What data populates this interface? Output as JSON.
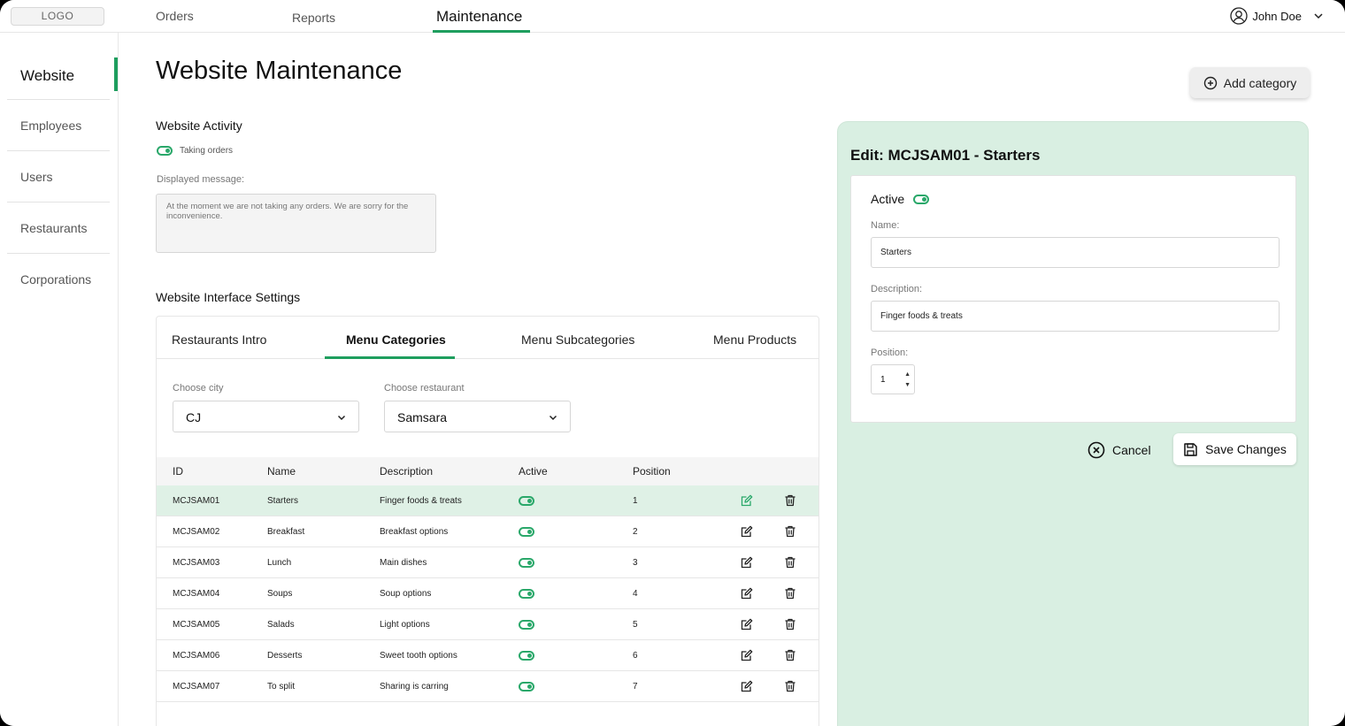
{
  "topbar": {
    "logo": "LOGO",
    "nav": [
      {
        "label": "Orders"
      },
      {
        "label": "Reports"
      },
      {
        "label": "Maintenance",
        "active": true
      }
    ],
    "user": {
      "name": "John Doe",
      "icon": "user-icon"
    }
  },
  "sidebar": {
    "items": [
      {
        "label": "Website",
        "active": true
      },
      {
        "label": "Employees"
      },
      {
        "label": "Users"
      },
      {
        "label": "Restaurants"
      },
      {
        "label": "Corporations"
      }
    ]
  },
  "main": {
    "title": "Website Maintenance",
    "add_category_label": "Add category",
    "activity": {
      "title": "Website Activity",
      "toggle_label": "Taking orders",
      "toggle_on": true,
      "message_label": "Displayed message:",
      "message": "At the moment we are not taking any orders. We are sorry for the inconvenience."
    },
    "interface": {
      "title": "Website Interface Settings",
      "tabs": [
        {
          "label": "Restaurants Intro"
        },
        {
          "label": "Menu Categories",
          "active": true
        },
        {
          "label": "Menu Subcategories"
        },
        {
          "label": "Menu Products"
        }
      ],
      "city": {
        "label": "Choose city",
        "value": "CJ"
      },
      "restaurant": {
        "label": "Choose restaurant",
        "value": "Samsara"
      },
      "table": {
        "headers": [
          "ID",
          "Name",
          "Description",
          "Active",
          "Position"
        ],
        "rows": [
          {
            "id": "MCJSAM01",
            "name": "Starters",
            "description": "Finger foods & treats",
            "active": true,
            "position": "1",
            "selected": true
          },
          {
            "id": "MCJSAM02",
            "name": "Breakfast",
            "description": "Breakfast options",
            "active": true,
            "position": "2"
          },
          {
            "id": "MCJSAM03",
            "name": "Lunch",
            "description": "Main dishes",
            "active": true,
            "position": "3"
          },
          {
            "id": "MCJSAM04",
            "name": "Soups",
            "description": "Soup options",
            "active": true,
            "position": "4"
          },
          {
            "id": "MCJSAM05",
            "name": "Salads",
            "description": "Light options",
            "active": true,
            "position": "5"
          },
          {
            "id": "MCJSAM06",
            "name": "Desserts",
            "description": "Sweet tooth options",
            "active": true,
            "position": "6"
          },
          {
            "id": "MCJSAM07",
            "name": "To split",
            "description": "Sharing is carring",
            "active": true,
            "position": "7"
          }
        ]
      }
    }
  },
  "edit_panel": {
    "title": "Edit: MCJSAM01 - Starters",
    "active_label": "Active",
    "active_on": true,
    "name_label": "Name:",
    "name_value": "Starters",
    "description_label": "Description:",
    "description_value": "Finger foods & treats",
    "position_label": "Position:",
    "position_value": "1",
    "cancel_label": "Cancel",
    "save_label": "Save Changes"
  },
  "colors": {
    "accent": "#1e9e5e",
    "panel_bg": "#d9efe2",
    "selected_row": "#dff1e6"
  }
}
